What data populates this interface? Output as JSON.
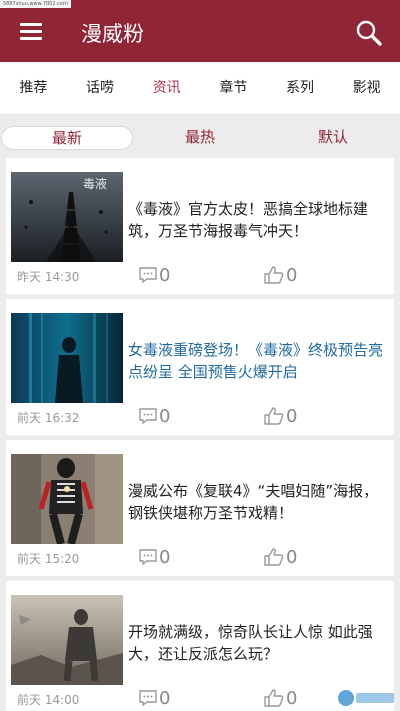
{
  "status_watermark": "5887shuu.www.7002.com",
  "app": {
    "title": "漫威粉"
  },
  "tabs": [
    {
      "label": "推荐"
    },
    {
      "label": "话唠"
    },
    {
      "label": "资讯",
      "active": true
    },
    {
      "label": "章节"
    },
    {
      "label": "系列"
    },
    {
      "label": "影视"
    }
  ],
  "sort": [
    {
      "label": "最新",
      "active": true
    },
    {
      "label": "最热"
    },
    {
      "label": "默认"
    }
  ],
  "articles": [
    {
      "title": "《毒液》官方太皮！恶搞全球地标建筑，万圣节海报毒气冲天！",
      "time": "昨天 14:30",
      "comments": "0",
      "likes": "0",
      "thumb_text": "毒液"
    },
    {
      "title": "女毒液重磅登场！《毒液》终极预告亮点纷呈 全国预售火爆开启",
      "time": "前天 16:32",
      "comments": "0",
      "likes": "0",
      "highlighted": true
    },
    {
      "title": "漫威公布《复联4》“夫唱妇随”海报，钢铁侠堪称万圣节戏精！",
      "time": "前天 15:20",
      "comments": "0",
      "likes": "0"
    },
    {
      "title": "开场就满级，惊奇队长让人惊 如此强大，还让反派怎么玩？",
      "time": "前天 14:00",
      "comments": "0",
      "likes": "0"
    }
  ],
  "colors": {
    "brand": "#8f2535",
    "accent": "#b0324a",
    "link": "#1f6aa0"
  },
  "icons": {
    "menu": "menu-icon",
    "search": "search-icon",
    "comment": "comment-icon",
    "like": "thumbs-up-icon"
  }
}
